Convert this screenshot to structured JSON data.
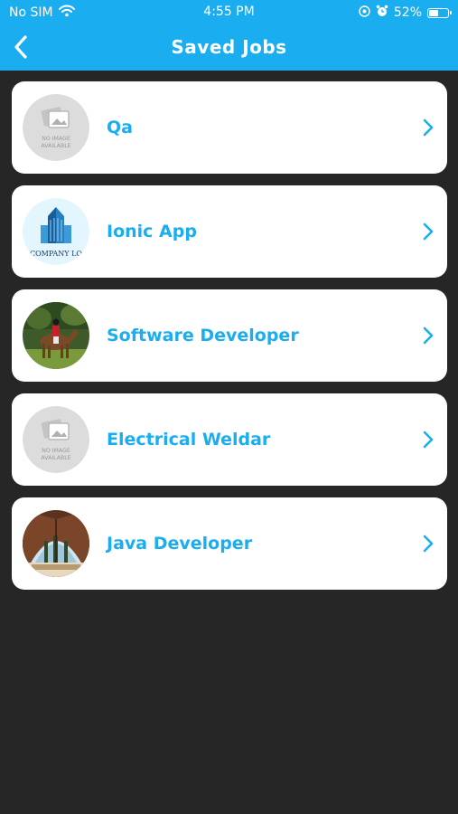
{
  "status_bar": {
    "carrier": "No SIM",
    "time": "4:55 PM",
    "battery_percent": "52%",
    "battery_level": 0.52,
    "icons": [
      "wifi-icon",
      "location-icon",
      "alarm-icon",
      "battery-icon"
    ]
  },
  "header": {
    "title": "Saved Jobs",
    "back_icon": "chevron-left-icon"
  },
  "colors": {
    "accent": "#1aaef0",
    "background": "#262626",
    "card": "#ffffff"
  },
  "jobs": [
    {
      "title": "Qa",
      "avatar": "no-image-placeholder",
      "placeholder_text": [
        "NO IMAGE",
        "AVAILABLE"
      ]
    },
    {
      "title": "Ionic App",
      "avatar": "company-logo",
      "logo_text": "COMPANY LO"
    },
    {
      "title": "Software Developer",
      "avatar": "horse-rider-photo"
    },
    {
      "title": "Electrical Weldar",
      "avatar": "no-image-placeholder",
      "placeholder_text": [
        "NO IMAGE",
        "AVAILABLE"
      ]
    },
    {
      "title": "Java Developer",
      "avatar": "tent-photo"
    }
  ]
}
